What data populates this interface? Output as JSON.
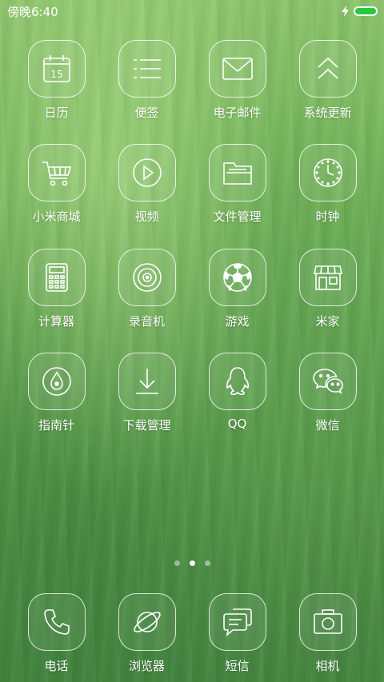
{
  "status_bar": {
    "time": "傍晚6:40",
    "charging_icon": "bolt-icon",
    "battery_color": "#27c93f"
  },
  "home_apps": [
    {
      "label": "日历",
      "icon": "calendar-icon",
      "day": "15"
    },
    {
      "label": "便签",
      "icon": "notes-icon"
    },
    {
      "label": "电子邮件",
      "icon": "mail-icon"
    },
    {
      "label": "系统更新",
      "icon": "update-icon"
    },
    {
      "label": "小米商城",
      "icon": "cart-icon"
    },
    {
      "label": "视频",
      "icon": "play-icon"
    },
    {
      "label": "文件管理",
      "icon": "folder-icon"
    },
    {
      "label": "时钟",
      "icon": "clock-icon"
    },
    {
      "label": "计算器",
      "icon": "calculator-icon"
    },
    {
      "label": "录音机",
      "icon": "recorder-icon"
    },
    {
      "label": "游戏",
      "icon": "soccer-ball-icon"
    },
    {
      "label": "米家",
      "icon": "store-icon"
    },
    {
      "label": "指南针",
      "icon": "compass-icon"
    },
    {
      "label": "下载管理",
      "icon": "download-icon"
    },
    {
      "label": "QQ",
      "icon": "penguin-icon"
    },
    {
      "label": "微信",
      "icon": "wechat-icon"
    }
  ],
  "page_indicator": {
    "total": 3,
    "active": 2
  },
  "dock_apps": [
    {
      "label": "电话",
      "icon": "phone-icon"
    },
    {
      "label": "浏览器",
      "icon": "browser-icon"
    },
    {
      "label": "短信",
      "icon": "message-icon"
    },
    {
      "label": "相机",
      "icon": "camera-icon"
    }
  ]
}
